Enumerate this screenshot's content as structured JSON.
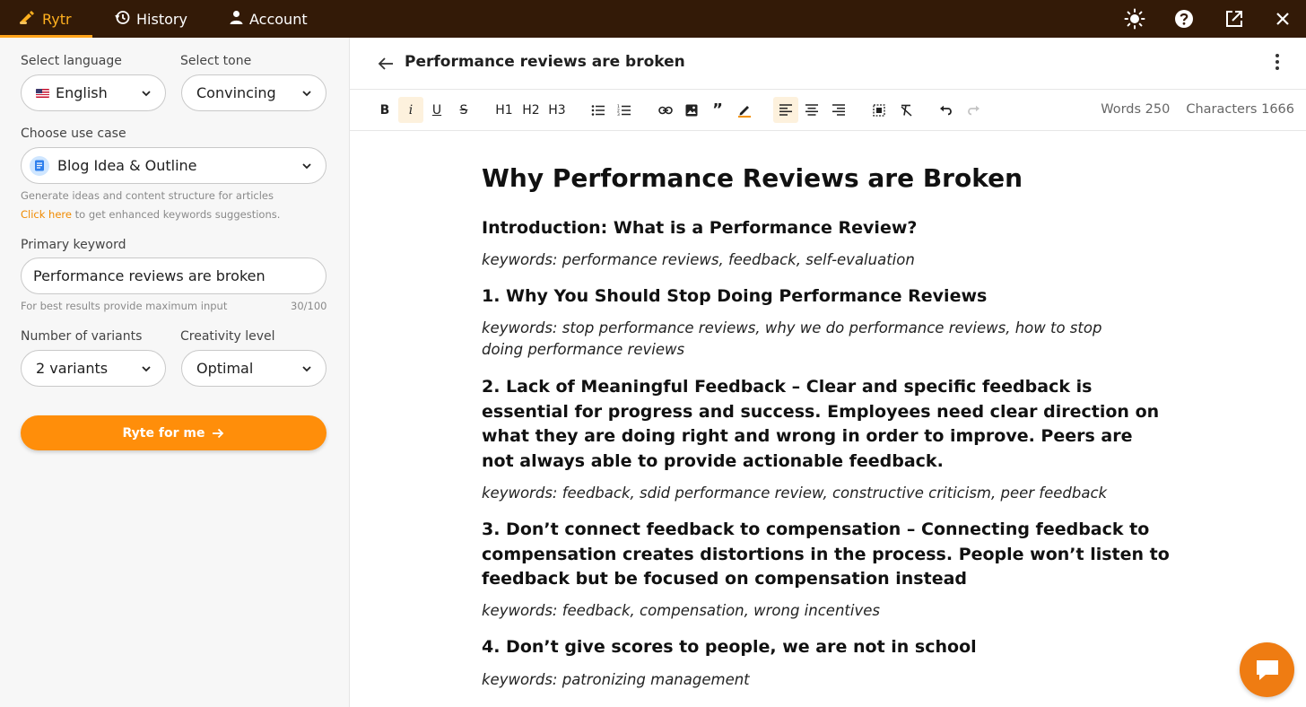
{
  "app": {
    "accent": "#ffa41b",
    "topbar_color": "#331a07",
    "nav": [
      {
        "label": "Rytr",
        "icon": "writing-hand-icon",
        "active": true
      },
      {
        "label": "History",
        "icon": "history-icon",
        "active": false
      },
      {
        "label": "Account",
        "icon": "user-icon",
        "active": false
      }
    ],
    "top_icons": [
      "sun-icon",
      "help-icon",
      "external-link-icon",
      "close-icon"
    ]
  },
  "sidebar": {
    "language": {
      "label": "Select language",
      "value": "English"
    },
    "tone": {
      "label": "Select tone",
      "value": "Convincing"
    },
    "use_case": {
      "label": "Choose use case",
      "value": "Blog Idea & Outline",
      "description": "Generate ideas and content structure for articles",
      "link_text": "Click here",
      "link_suffix": " to get enhanced keywords suggestions."
    },
    "keyword": {
      "label": "Primary keyword",
      "value": "Performance reviews are broken",
      "hint": "For best results provide maximum input",
      "counter": "30/100"
    },
    "variants": {
      "label": "Number of variants",
      "value": "2 variants"
    },
    "creativity": {
      "label": "Creativity level",
      "value": "Optimal"
    },
    "cta": "Ryte for me"
  },
  "editor": {
    "title": "Performance reviews are broken",
    "toolbar": {
      "bold": "B",
      "italic": "i",
      "underline": "U",
      "strike": "S",
      "h1": "H1",
      "h2": "H2",
      "h3": "H3"
    },
    "words_label": "Words 250",
    "characters_label": "Characters 1666",
    "doc": {
      "h1": "Why Performance Reviews are Broken",
      "sections": [
        {
          "heading": "Introduction: What is a Performance Review?",
          "keywords": "keywords: performance reviews, feedback, self-evaluation"
        },
        {
          "heading": "1. Why You Should Stop Doing Performance Reviews",
          "keywords": "keywords: stop performance reviews, why we do performance reviews, how to stop doing performance reviews"
        },
        {
          "heading": "2. Lack of Meaningful Feedback – Clear and specific feedback is essential for progress and success. Employees need clear direction on what they are doing right and wrong in order to improve. Peers are not always able to provide actionable feedback.",
          "keywords": "keywords: feedback, sdid performance review, constructive criticism, peer feedback"
        },
        {
          "heading": "3. Don’t connect feedback to compensation – Connecting feedback to compensation creates distortions in the process. People won’t listen to feedback but be focused on compensation instead",
          "keywords": "keywords: feedback, compensation, wrong incentives"
        },
        {
          "heading": "4. Don’t give scores to people, we are not in school",
          "keywords": "keywords: patronizing management"
        }
      ]
    }
  }
}
